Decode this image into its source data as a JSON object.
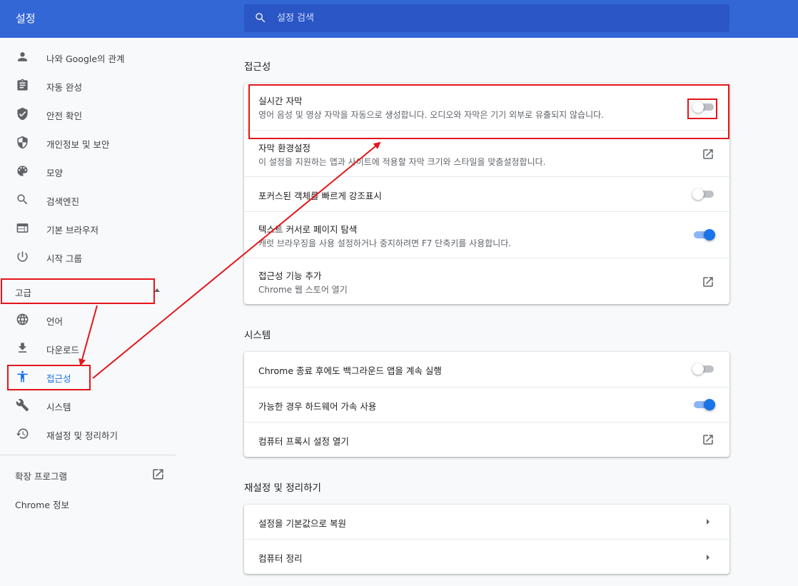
{
  "header": {
    "title": "설정",
    "search_placeholder": "설정 검색"
  },
  "sidebar": {
    "items": [
      {
        "label": "나와 Google의 관계",
        "icon": "person-icon"
      },
      {
        "label": "자동 완성",
        "icon": "clipboard-icon"
      },
      {
        "label": "안전 확인",
        "icon": "shield-check-icon"
      },
      {
        "label": "개인정보 및 보안",
        "icon": "shield-half-icon"
      },
      {
        "label": "모양",
        "icon": "palette-icon"
      },
      {
        "label": "검색엔진",
        "icon": "search-icon"
      },
      {
        "label": "기본 브라우저",
        "icon": "browser-icon"
      },
      {
        "label": "시작 그룹",
        "icon": "power-icon"
      }
    ],
    "advanced_label": "고급",
    "advanced_items": [
      {
        "label": "언어",
        "icon": "globe-icon"
      },
      {
        "label": "다운로드",
        "icon": "download-icon"
      },
      {
        "label": "접근성",
        "icon": "accessibility-icon",
        "active": true
      },
      {
        "label": "시스템",
        "icon": "wrench-icon"
      },
      {
        "label": "재설정 및 정리하기",
        "icon": "history-icon"
      }
    ],
    "extensions_label": "확장 프로그램",
    "about_label": "Chrome 정보"
  },
  "accessibility": {
    "title": "접근성",
    "rows": [
      {
        "title": "실시간 자막",
        "subtitle": "영어 음성 및 영상 자막을 자동으로 생성합니다. 오디오와 자막은 기기 외부로 유출되지 않습니다.",
        "control": "toggle",
        "on": false
      },
      {
        "title": "자막 환경설정",
        "subtitle": "이 설정을 지원하는 앱과 사이트에 적용할 자막 크기와 스타일을 맞춤설정합니다.",
        "control": "external"
      },
      {
        "title": "포커스된 객체를 빠르게 강조표시",
        "control": "toggle",
        "on": false
      },
      {
        "title": "텍스트 커서로 페이지 탐색",
        "subtitle": "캐럿 브라우징을 사용 설정하거나 중지하려면 F7 단축키를 사용합니다.",
        "control": "toggle",
        "on": true
      },
      {
        "title": "접근성 기능 추가",
        "subtitle": "Chrome 웹 스토어 열기",
        "control": "external"
      }
    ]
  },
  "system": {
    "title": "시스템",
    "rows": [
      {
        "title": "Chrome 종료 후에도 백그라운드 앱을 계속 실행",
        "control": "toggle",
        "on": false
      },
      {
        "title": "가능한 경우 하드웨어 가속 사용",
        "control": "toggle",
        "on": true
      },
      {
        "title": "컴퓨터 프록시 설정 열기",
        "control": "external"
      }
    ]
  },
  "reset": {
    "title": "재설정 및 정리하기",
    "rows": [
      {
        "title": "설정을 기본값으로 복원",
        "control": "arrow"
      },
      {
        "title": "컴퓨터 정리",
        "control": "arrow"
      }
    ]
  },
  "colors": {
    "header": "#3367d6",
    "search": "#2a56c6",
    "accent": "#1a73e8",
    "annotation": "#e4151b"
  }
}
